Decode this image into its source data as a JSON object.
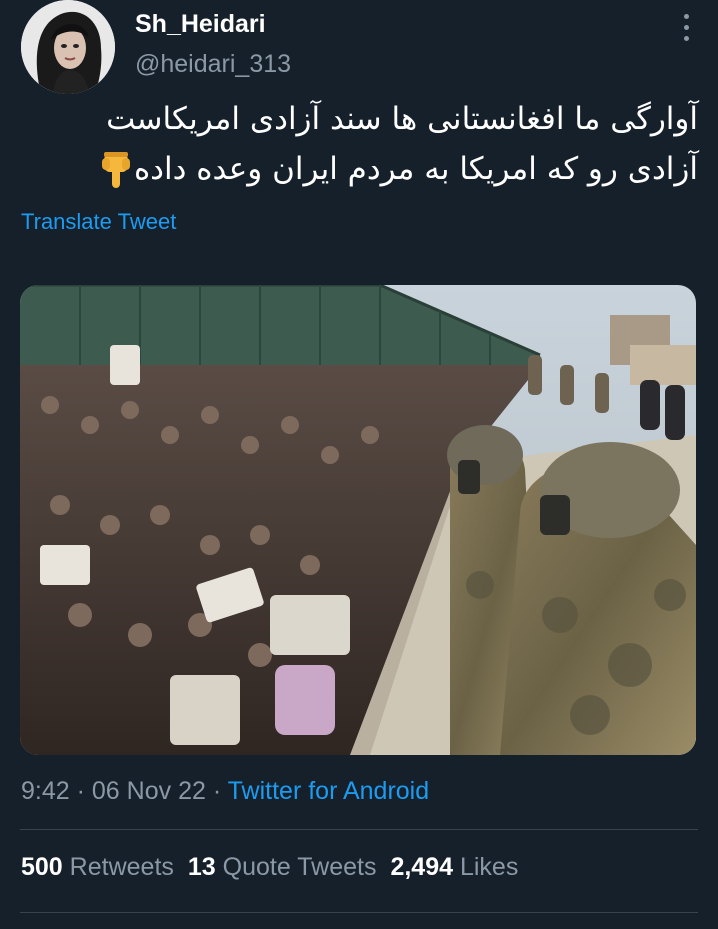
{
  "author": {
    "display_name": "Sh_Heidari",
    "handle": "@heidari_313"
  },
  "tweet": {
    "lines": [
      "آوارگی ما افغانستانی ها سند آزادی امریکاست",
      "آزادی رو که امریکا به مردم ایران وعده داده"
    ],
    "emoji": "pointing-down-hand"
  },
  "translate_label": "Translate Tweet",
  "meta": {
    "time": "9:42",
    "date": "06 Nov 22",
    "separator": "·",
    "source": "Twitter for Android"
  },
  "stats": {
    "retweets_count": "500",
    "retweets_label": "Retweets",
    "quotes_count": "13",
    "quotes_label": "Quote Tweets",
    "likes_count": "2,494",
    "likes_label": "Likes"
  },
  "colors": {
    "background": "#15202b",
    "link": "#1d9bf0",
    "secondary_text": "#8b98a5",
    "divider": "#38444d"
  }
}
